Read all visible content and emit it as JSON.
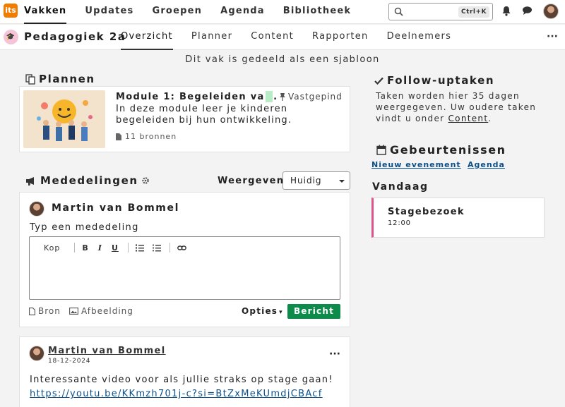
{
  "topnav": {
    "logo_text": "its",
    "items": [
      "Vakken",
      "Updates",
      "Groepen",
      "Agenda",
      "Bibliotheek"
    ],
    "search_shortcut": "Ctrl+K"
  },
  "course": {
    "title": "Pedagogiek 2a",
    "tabs": [
      "Overzicht",
      "Planner",
      "Content",
      "Rapporten",
      "Deelnemers"
    ],
    "more": "···",
    "shared_notice": "Dit vak is gedeeld als een sjabloon"
  },
  "plans": {
    "heading": "Plannen",
    "module": {
      "title": "Module 1: Begeleiden va...",
      "pinned": "Vastgepind",
      "description": "In deze module leer je kinderen begeleiden bij hun ontwikkeling.",
      "sources": "11 bronnen"
    }
  },
  "announcements": {
    "heading": "Mededelingen",
    "view_label": "Weergeven",
    "view_value": "Huidig",
    "composer": {
      "author": "Martin van Bommel",
      "label": "Typ een mededeling",
      "heading_btn": "Kop",
      "bold": "B",
      "italic": "I",
      "underline": "U",
      "source": "Bron",
      "image": "Afbeelding",
      "options": "Opties",
      "submit": "Bericht"
    },
    "post": {
      "author": "Martin van Bommel",
      "date": "18-12-2024",
      "more": "···",
      "text": "Interessante video voor als jullie straks op stage gaan!",
      "link": "https://youtu.be/KKmzh701j-c?si=BtZxMeKUmdjCBAcf"
    }
  },
  "followup": {
    "heading": "Follow-uptaken",
    "text_before": "Taken worden hier 35 dagen weergegeven. Uw oudere taken vindt u onder ",
    "link": "Content",
    "text_after": "."
  },
  "events": {
    "heading": "Gebeurtenissen",
    "new_event": "Nieuw evenement",
    "agenda": "Agenda",
    "today_heading": "Vandaag",
    "today_items": [
      {
        "title": "Stagebezoek",
        "time": "12:00"
      }
    ]
  },
  "colors": {
    "brand": "#f07d00",
    "accent_green": "#0c8b4a",
    "event_border": "#d9558a",
    "link": "#0b4f8a"
  }
}
